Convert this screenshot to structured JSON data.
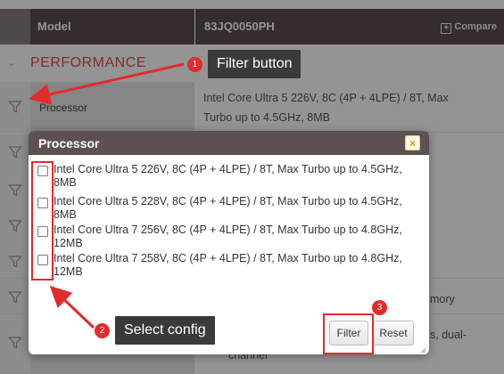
{
  "table": {
    "header_model": "Model",
    "header_product": "83JQ0050PH",
    "compare_label": "Compare",
    "section": "PERFORMANCE",
    "processor_label": "Processor",
    "processor_value_line1": "Intel Core Ultra 5 226V, 8C (4P + 4LPE) / 8T, Max",
    "processor_value_line2": "Turbo up to 4.5GHz, 8MB",
    "partial_right_1": "mory",
    "partial_right_2": "s, dual-",
    "partial_right_3": "channel"
  },
  "modal": {
    "title": "Processor",
    "close_glyph": "×",
    "options": [
      {
        "line1": "Intel Core Ultra 5 226V, 8C (4P + 4LPE) / 8T, Max Turbo up to 4.5GHz,",
        "line2": "8MB",
        "checked": false
      },
      {
        "line1": "Intel Core Ultra 5 228V, 8C (4P + 4LPE) / 8T, Max Turbo up to 4.5GHz,",
        "line2": "8MB",
        "checked": false
      },
      {
        "line1": "Intel Core Ultra 7 256V, 8C (4P + 4LPE) / 8T, Max Turbo up to 4.8GHz,",
        "line2": "12MB",
        "checked": false
      },
      {
        "line1": "Intel Core Ultra 7 258V, 8C (4P + 4LPE) / 8T, Max Turbo up to 4.8GHz,",
        "line2": "12MB",
        "checked": false
      }
    ],
    "filter_label": "Filter",
    "reset_label": "Reset"
  },
  "annotations": [
    {
      "number": "1",
      "label": "Filter button"
    },
    {
      "number": "2",
      "label": "Select config"
    },
    {
      "number": "3",
      "label": ""
    }
  ],
  "colors": {
    "header_bg": "#5a4d4e",
    "accent_red": "#e22b2b",
    "section_red": "#d55252"
  },
  "icons": {
    "filter": "funnel-icon",
    "compare": "plus-square-icon",
    "close": "close-icon",
    "collapse": "chevron-down-icon"
  }
}
